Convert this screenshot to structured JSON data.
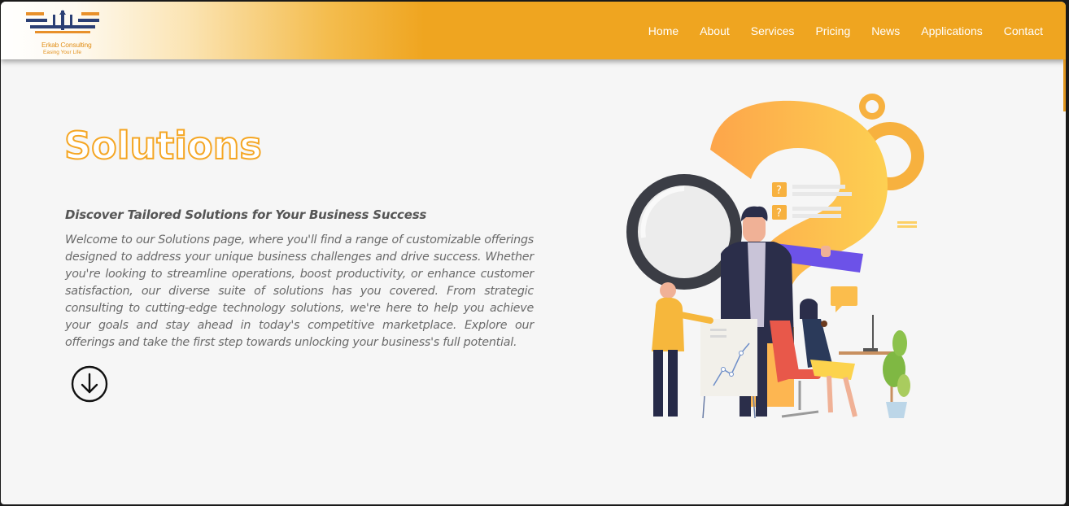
{
  "brand": {
    "name": "Erkab Consulting",
    "tagline": "Easing Your Life"
  },
  "nav": {
    "items": [
      {
        "label": "Home"
      },
      {
        "label": "About"
      },
      {
        "label": "Services"
      },
      {
        "label": "Pricing"
      },
      {
        "label": "News"
      },
      {
        "label": "Applications"
      },
      {
        "label": "Contact"
      }
    ]
  },
  "hero": {
    "title": "Solutions",
    "subtitle": "Discover Tailored Solutions for Your Business Success",
    "body": "Welcome to our Solutions page, where you'll find a range of customizable offerings designed to address your unique business challenges and drive success. Whether you're looking to streamline operations, boost productivity, or enhance customer satisfaction, our diverse suite of solutions has you covered. From strategic consulting to cutting-edge technology solutions, we're here to help you achieve your goals and stay ahead in today's competitive marketplace. Explore our offerings and take the first step towards unlocking your business's full potential.",
    "scroll_icon": "arrow-down-circle-icon",
    "illustration_icon": "team-question-mark-illustration"
  },
  "colors": {
    "accent": "#efa520",
    "title_stroke": "#f5a623",
    "text": "#6a6a6a"
  }
}
